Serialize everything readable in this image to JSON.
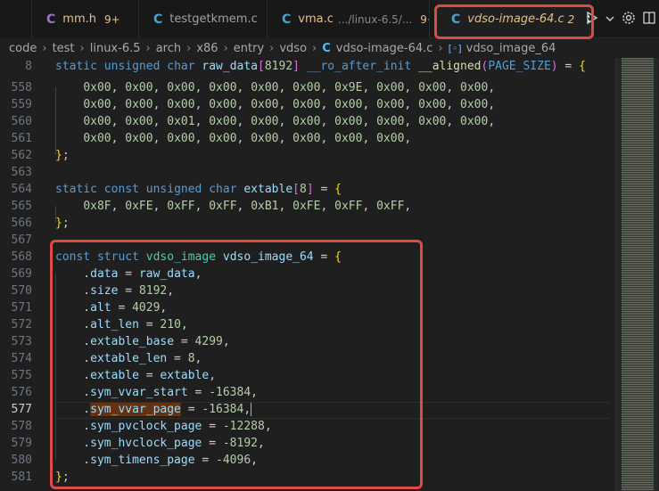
{
  "tabs": [
    {
      "type": "C",
      "name": "mm.h",
      "path": "",
      "badge": "9+",
      "active": false
    },
    {
      "type": "C",
      "name": "testgetkmem.c",
      "path": "",
      "badge": "",
      "active": false
    },
    {
      "type": "C",
      "name": "vma.c",
      "path": ".../linux-6.5/...",
      "badge": "9+",
      "active": false
    },
    {
      "type": "C",
      "name": "vdso-image-64.c",
      "path": "",
      "badge": "2",
      "active": true
    }
  ],
  "tab_close_glyph": "✕",
  "breadcrumb": {
    "parts": [
      "code",
      "test",
      "linux-6.5",
      "arch",
      "x86",
      "entry",
      "vdso"
    ],
    "file": "vdso-image-64.c",
    "symbol": "vdso_image_64",
    "file_icon": "C",
    "symbol_icon": "[◦]"
  },
  "editor": {
    "sticky": {
      "num": "8",
      "text": "static unsigned char raw_data[8192] __ro_after_init __aligned(PAGE_SIZE) = {"
    },
    "lines": [
      {
        "num": "558",
        "text": "    0x00, 0x00, 0x00, 0x00, 0x00, 0x00, 0x9E, 0x00, 0x00, 0x00,"
      },
      {
        "num": "559",
        "text": "    0x00, 0x00, 0x00, 0x00, 0x00, 0x00, 0x00, 0x00, 0x00, 0x00,"
      },
      {
        "num": "560",
        "text": "    0x00, 0x00, 0x01, 0x00, 0x00, 0x00, 0x00, 0x00, 0x00, 0x00,"
      },
      {
        "num": "561",
        "text": "    0x00, 0x00, 0x00, 0x00, 0x00, 0x00, 0x00, 0x00,"
      },
      {
        "num": "562",
        "text": "};"
      },
      {
        "num": "563",
        "text": ""
      },
      {
        "num": "564",
        "text": "static const unsigned char extable[8] = {"
      },
      {
        "num": "565",
        "text": "    0x8F, 0xFE, 0xFF, 0xFF, 0xB1, 0xFE, 0xFF, 0xFF,"
      },
      {
        "num": "566",
        "text": "};"
      },
      {
        "num": "567",
        "text": ""
      },
      {
        "num": "568",
        "text": "const struct vdso_image vdso_image_64 = {"
      },
      {
        "num": "569",
        "text": "    .data = raw_data,"
      },
      {
        "num": "570",
        "text": "    .size = 8192,"
      },
      {
        "num": "571",
        "text": "    .alt = 4029,"
      },
      {
        "num": "572",
        "text": "    .alt_len = 210,"
      },
      {
        "num": "573",
        "text": "    .extable_base = 4299,"
      },
      {
        "num": "574",
        "text": "    .extable_len = 8,"
      },
      {
        "num": "575",
        "text": "    .extable = extable,"
      },
      {
        "num": "576",
        "text": "    .sym_vvar_start = -16384,"
      },
      {
        "num": "577",
        "text": "    .sym_vvar_page = -16384,"
      },
      {
        "num": "578",
        "text": "    .sym_pvclock_page = -12288,"
      },
      {
        "num": "579",
        "text": "    .sym_hvclock_page = -8192,"
      },
      {
        "num": "580",
        "text": "    .sym_timens_page = -4096,"
      },
      {
        "num": "581",
        "text": "};"
      }
    ],
    "current_line": "577",
    "highlighted_word": "sym_vvar_page"
  },
  "colors": {
    "keyword": "#569cd6",
    "type": "#4ec9b0",
    "identifier": "#9cdcfe",
    "number": "#b5cea8",
    "function": "#dcdcaa",
    "bracket_gold": "#ffd700",
    "bracket_pink": "#da70d6",
    "annotation_red": "#e0484a",
    "active_tab_text": "#e2c08d",
    "badge": "#e2c08d"
  }
}
